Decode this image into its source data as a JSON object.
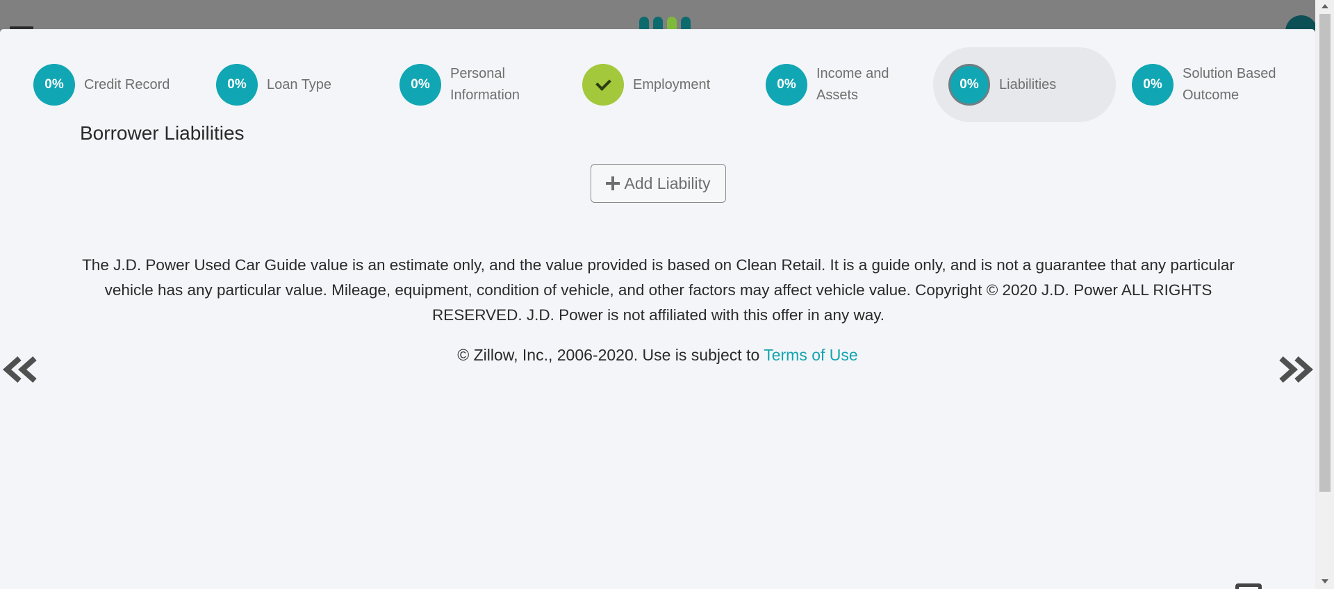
{
  "steps": [
    {
      "label": "Credit Record",
      "progress": "0%",
      "status": "incomplete"
    },
    {
      "label": "Loan Type",
      "progress": "0%",
      "status": "incomplete"
    },
    {
      "label": "Personal Information",
      "progress": "0%",
      "status": "incomplete"
    },
    {
      "label": "Employment",
      "progress": "",
      "status": "complete"
    },
    {
      "label": "Income and Assets",
      "progress": "0%",
      "status": "incomplete"
    },
    {
      "label": "Liabilities",
      "progress": "0%",
      "status": "current"
    },
    {
      "label": "Solution Based Outcome",
      "progress": "0%",
      "status": "incomplete"
    }
  ],
  "section": {
    "title": "Borrower Liabilities",
    "add_button_label": "Add Liability"
  },
  "footer": {
    "disclaimer": "The J.D. Power Used Car Guide value is an estimate only, and the value provided is based on Clean Retail. It is a guide only, and is not a guarantee that any particular vehicle has any particular value. Mileage, equipment, condition of vehicle, and other factors may affect vehicle value. Copyright © 2020 J.D. Power ALL RIGHTS RESERVED. J.D. Power is not affiliated with this offer in any way.",
    "copyright_prefix": "© Zillow, Inc., 2006-2020. Use is subject to ",
    "terms_link": "Terms of Use"
  },
  "icons": {
    "prev": "double-chevron-left-icon",
    "next": "double-chevron-right-icon",
    "complete": "check-icon",
    "add": "plus-icon"
  },
  "colors": {
    "step_incomplete": "#11a6b3",
    "step_complete": "#a3c83c",
    "link": "#14a4b0",
    "modal_background": "#f3f5f8",
    "backdrop": "#808080"
  }
}
